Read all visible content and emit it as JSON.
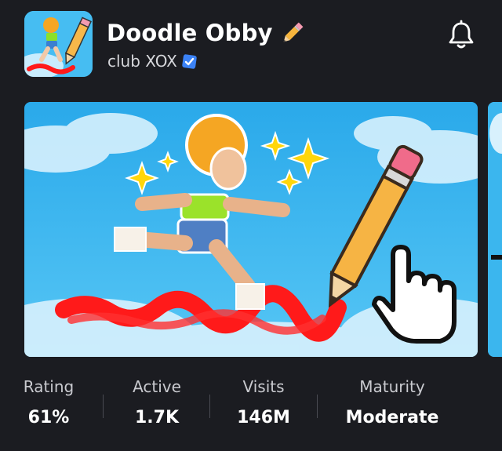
{
  "game": {
    "title": "Doodle Obby",
    "title_emoji": "pencil-icon",
    "creator": "club XOX",
    "creator_verified": true
  },
  "header": {
    "notify_icon": "bell-icon"
  },
  "colors": {
    "background": "#1b1c21",
    "verified_badge": "#3b82f6",
    "sky": "#3bb6ee",
    "scribble": "#ff1a1a"
  },
  "stats": [
    {
      "label": "Rating",
      "value": "61%"
    },
    {
      "label": "Active",
      "value": "1.7K"
    },
    {
      "label": "Visits",
      "value": "146M"
    },
    {
      "label": "Maturity",
      "value": "Moderate"
    }
  ]
}
